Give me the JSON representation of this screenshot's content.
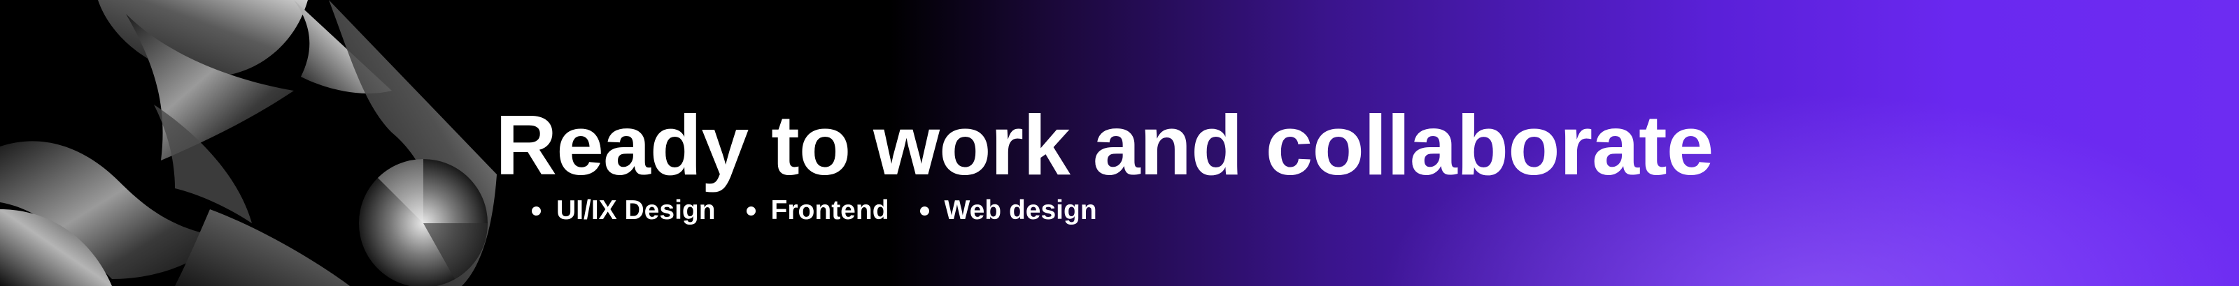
{
  "banner": {
    "headline": "Ready to work and collaborate",
    "tags": [
      {
        "label": "UI/IX Design"
      },
      {
        "label": "Frontend"
      },
      {
        "label": "Web design"
      }
    ],
    "colors": {
      "background_left": "#000000",
      "background_right": "#6d2cf2",
      "text": "#ffffff"
    }
  }
}
